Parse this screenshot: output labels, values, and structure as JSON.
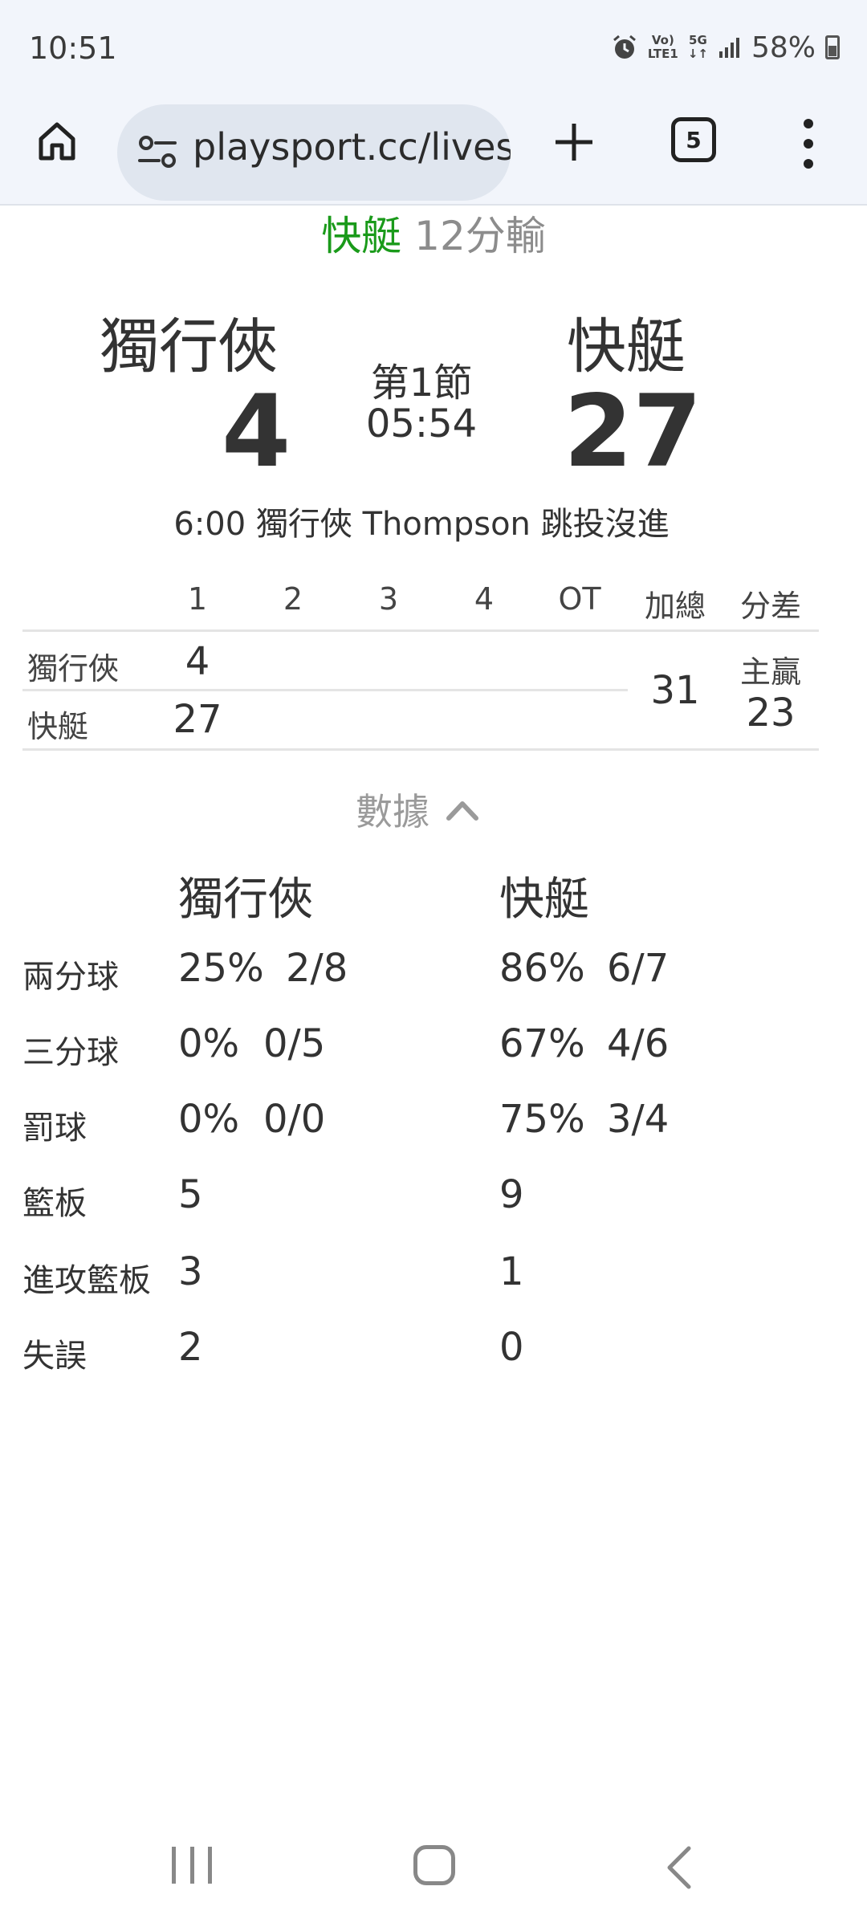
{
  "status_bar": {
    "time": "10:51",
    "volte": "Vo)",
    "lte": "LTE1",
    "net": "5G",
    "battery_pct": "58%"
  },
  "browser": {
    "url": "playsport.cc/lives",
    "tab_count": "5"
  },
  "game": {
    "result_winner": "快艇",
    "result_margin": "12分輸",
    "away_team": "獨行俠",
    "away_score": "4",
    "home_team": "快艇",
    "home_score": "27",
    "period": "第1節",
    "clock": "05:54",
    "last_play": "6:00 獨行俠 Thompson 跳投沒進"
  },
  "box_score": {
    "headers": [
      "1",
      "2",
      "3",
      "4",
      "OT",
      "加總",
      "分差"
    ],
    "rows": [
      {
        "team": "獨行俠",
        "q1": "4"
      },
      {
        "team": "快艇",
        "q1": "27"
      }
    ],
    "total": "31",
    "diff_label": "主贏",
    "diff_value": "23"
  },
  "stats": {
    "toggle_label": "數據",
    "away_team": "獨行俠",
    "home_team": "快艇",
    "rows": [
      {
        "label": "兩分球",
        "away_pct": "25%",
        "away_made": "2/8",
        "home_pct": "86%",
        "home_made": "6/7"
      },
      {
        "label": "三分球",
        "away_pct": "0%",
        "away_made": "0/5",
        "home_pct": "67%",
        "home_made": "4/6"
      },
      {
        "label": "罰球",
        "away_pct": "0%",
        "away_made": "0/0",
        "home_pct": "75%",
        "home_made": "3/4"
      },
      {
        "label": "籃板",
        "away_pct": "5",
        "away_made": "",
        "home_pct": "9",
        "home_made": ""
      },
      {
        "label": "進攻籃板",
        "away_pct": "3",
        "away_made": "",
        "home_pct": "1",
        "home_made": ""
      },
      {
        "label": "失誤",
        "away_pct": "2",
        "away_made": "",
        "home_pct": "0",
        "home_made": ""
      }
    ]
  },
  "colors": {
    "winner_green": "#1a9a1a",
    "muted_gray": "#8c8c8c",
    "browser_bg": "#f2f5fb",
    "urlbar_bg": "#e0e6ef"
  },
  "icons": {
    "home": "home-icon",
    "site_settings": "site-settings-icon",
    "new_tab": "plus-icon",
    "menu": "more-vert-icon",
    "alarm": "alarm-icon",
    "signal": "signal-icon",
    "battery": "battery-icon",
    "collapse": "chevron-up-icon"
  }
}
